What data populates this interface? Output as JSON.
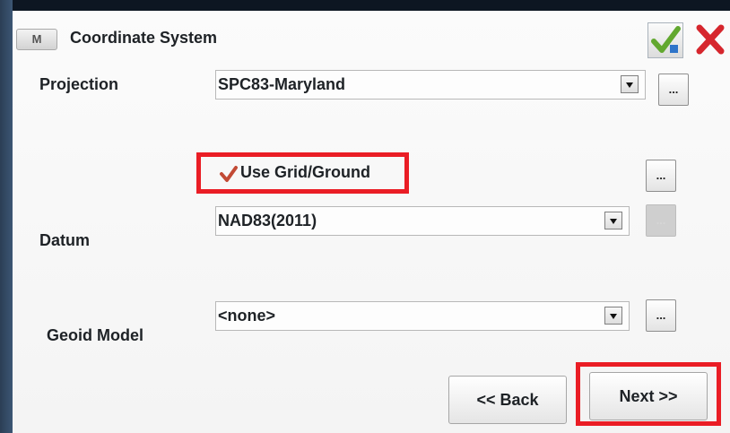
{
  "window": {
    "app_icon_letter": "M",
    "title": "Coordinate System",
    "ok_icon": "checkmark-icon",
    "cancel_icon": "close-x-icon"
  },
  "form": {
    "projection": {
      "label": "Projection",
      "value": "SPC83-Maryland",
      "more_button": "..."
    },
    "grid_ground": {
      "label": "Use Grid/Ground",
      "checked": true,
      "more_button": "..."
    },
    "datum": {
      "label": "Datum",
      "value": "NAD83(2011)",
      "more_button": "..."
    },
    "geoid": {
      "label": "Geoid Model",
      "value": "<none>",
      "more_button": "..."
    }
  },
  "navigation": {
    "back_label": "<< Back",
    "next_label": "Next >>"
  },
  "colors": {
    "highlight_red": "#ea1d25",
    "check_green": "#62a82f",
    "check_mark": "#c24a35"
  }
}
